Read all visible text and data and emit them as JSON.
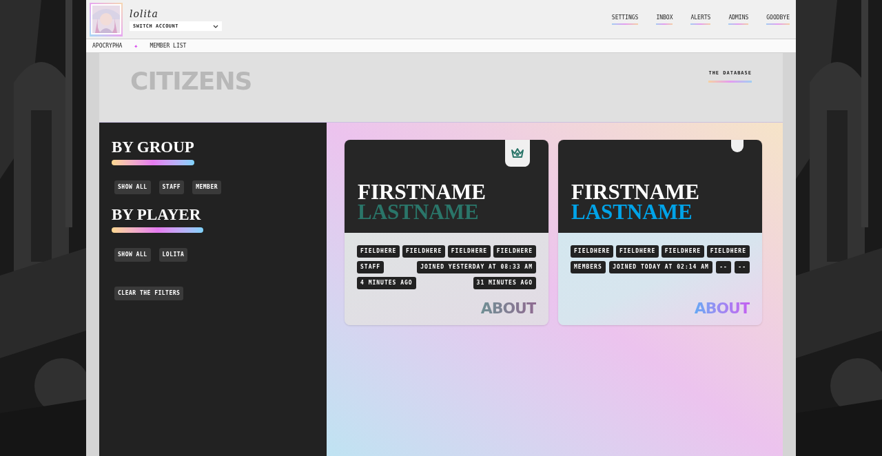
{
  "account": {
    "username": "lolita",
    "switch_label": "SWITCH ACCOUNT"
  },
  "top_nav": [
    "SETTINGS",
    "INBOX",
    "ALERTS",
    "ADMINS",
    "GOODBYE"
  ],
  "breadcrumb": {
    "items": [
      "APOCRYPHA",
      "MEMBER LIST"
    ],
    "separator": "✦"
  },
  "banner": {
    "title": "CITIZENS",
    "link": "THE DATABASE"
  },
  "sidebar": {
    "sections": [
      {
        "title": "BY GROUP",
        "filters": [
          "SHOW ALL",
          "STAFF",
          "MEMBER"
        ]
      },
      {
        "title": "BY PLAYER",
        "filters": [
          "SHOW ALL",
          "LOLITA"
        ]
      }
    ],
    "clear_button": "CLEAR THE FILTERS"
  },
  "cards": [
    {
      "kind": "staff",
      "crowned": true,
      "firstname": "FIRSTNAME",
      "lastname": "LASTNAME",
      "color": "#2a7569",
      "fields": [
        "FIELDHERE",
        "FIELDHERE",
        "FIELDHERE",
        "FIELDHERE"
      ],
      "tags": [
        "STAFF",
        "JOINED YESTERDAY AT 08:33 AM",
        "4 MINUTES AGO",
        "31 MINUTES AGO"
      ],
      "about": "ABOUT"
    },
    {
      "kind": "member",
      "crowned": false,
      "firstname": "FIRSTNAME",
      "lastname": "LASTNAME",
      "color": "#00a3e8",
      "fields": [
        "FIELDHERE",
        "FIELDHERE",
        "FIELDHERE",
        "FIELDHERE"
      ],
      "tags": [
        "MEMBERS",
        "JOINED TODAY AT 02:14 AM",
        "--",
        "--"
      ],
      "about": "ABOUT"
    }
  ]
}
